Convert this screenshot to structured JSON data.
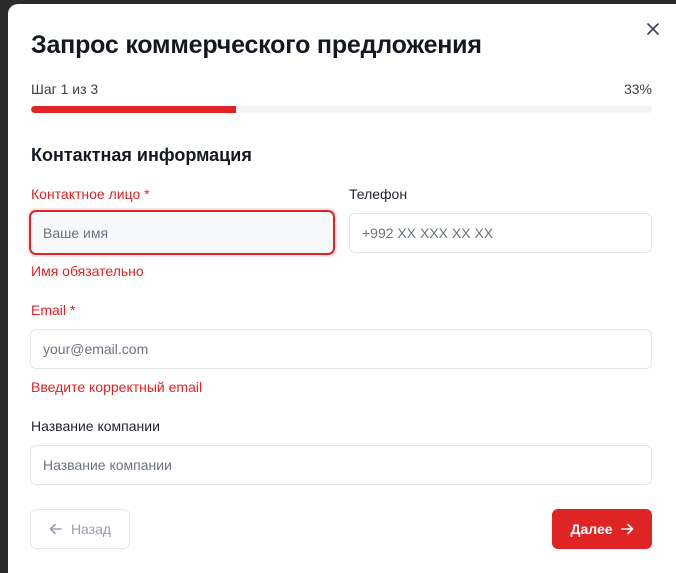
{
  "modal": {
    "title": "Запрос коммерческого предложения",
    "close_icon": "close-icon"
  },
  "progress": {
    "step_label": "Шаг 1 из 3",
    "percent_label": "33%",
    "fraction": 0.33,
    "fill_color": "#e02424"
  },
  "section": {
    "title": "Контактная информация"
  },
  "fields": {
    "contact_person": {
      "label": "Контактное лицо *",
      "placeholder": "Ваше имя",
      "value": "",
      "error": "Имя обязательно"
    },
    "phone": {
      "label": "Телефон",
      "placeholder": "+992 XX XXX XX XX",
      "value": ""
    },
    "email": {
      "label": "Email *",
      "placeholder": "your@email.com",
      "value": "",
      "error": "Введите корректный email"
    },
    "company": {
      "label": "Название компании",
      "placeholder": "Название компании",
      "value": ""
    }
  },
  "buttons": {
    "back_label": "Назад",
    "back_icon": "arrow-left-icon",
    "next_label": "Далее",
    "next_icon": "arrow-right-icon"
  },
  "colors": {
    "accent": "#e02424",
    "error": "#e02424"
  }
}
